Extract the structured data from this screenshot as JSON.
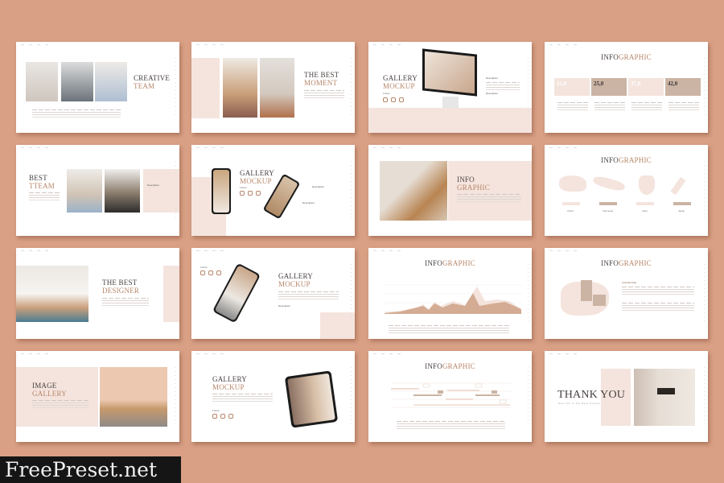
{
  "colors": {
    "background": "#d9a085",
    "accent": "#b8866a",
    "pink": "#f4e4dd",
    "tan": "#cbb4a4",
    "title": "#4a4242"
  },
  "slides": {
    "s1": {
      "title": "CREATIVE",
      "accent": "TEAM"
    },
    "s2": {
      "title": "THE BEST",
      "accent": "MOMENT"
    },
    "s3": {
      "title": "GALLERY",
      "accent": "MOCKUP",
      "follow": "Follow",
      "desc1": "Description",
      "desc2": "Description"
    },
    "s4": {
      "title": "INFO",
      "accent": "GRAPHIC",
      "stats": [
        "12,0",
        "25,0",
        "37,0",
        "42,0"
      ]
    },
    "s5": {
      "title": "BEST",
      "accent": "TTEAM",
      "desc": "Description"
    },
    "s6": {
      "title": "GALLERY",
      "accent": "MOCKUP",
      "follow": "Follow",
      "desc1": "Description",
      "desc2": "Description"
    },
    "s7": {
      "title": "INFO",
      "accent": "GRAPHIC"
    },
    "s8": {
      "title": "INFO",
      "accent": "GRAPHIC",
      "countries": [
        "China",
        "Indonesia",
        "India",
        "Japan"
      ]
    },
    "s9": {
      "title": "THE BEST",
      "accent": "DESIGNER"
    },
    "s10": {
      "title": "GALLERY",
      "accent": "MOCKUP",
      "follow": "Follow",
      "desc": "Description"
    },
    "s11": {
      "title": "INFO",
      "accent": "GRAPHIC"
    },
    "s12": {
      "title": "INFO",
      "accent": "GRAPHIC",
      "desc": "Australia Map"
    },
    "s13": {
      "title": "IMAGE",
      "accent": "GALLERY"
    },
    "s14": {
      "title": "GALLERY",
      "accent": "MOCKUP",
      "follow": "Follow"
    },
    "s15": {
      "title": "INFO",
      "accent": "GRAPHIC"
    },
    "s16": {
      "title": "THANK YOU",
      "subtitle": "See You in the Next Project"
    }
  },
  "watermark": "FreePreset.net"
}
